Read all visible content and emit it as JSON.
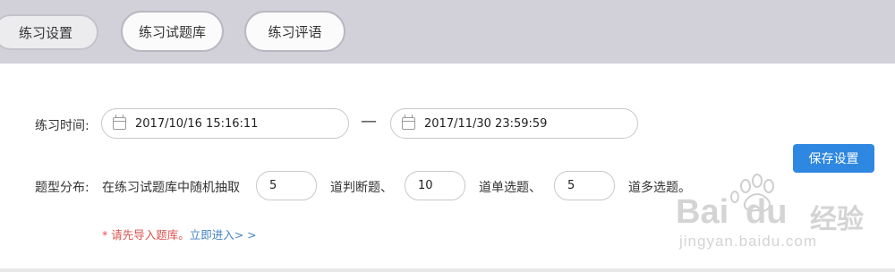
{
  "tabs": [
    {
      "label": "练习设置",
      "active": true
    },
    {
      "label": "练习试题库",
      "active": false
    },
    {
      "label": "练习评语",
      "active": false
    }
  ],
  "time": {
    "label": "练习时间:",
    "start": "2017/10/16 15:16:11",
    "separator": "—",
    "end": "2017/11/30 23:59:59"
  },
  "distribution": {
    "label": "题型分布:",
    "prefix": "在练习试题库中随机抽取",
    "judge_count": "5",
    "judge_suffix": "道判断题、",
    "single_count": "10",
    "single_suffix": "道单选题、",
    "multi_count": "5",
    "multi_suffix": "道多选题。"
  },
  "notice": {
    "text": "* 请先导入题库。",
    "link": "立即进入> >"
  },
  "save_button": "保存设置",
  "watermark": {
    "brand_left": "Bai",
    "brand_right": "du",
    "brand_cn": "经验",
    "url": "jingyan.baidu.com"
  },
  "colors": {
    "topbar": "#d2d1d9",
    "primary": "#2e87e0",
    "warning": "#d9534f",
    "link": "#3f82c4"
  }
}
